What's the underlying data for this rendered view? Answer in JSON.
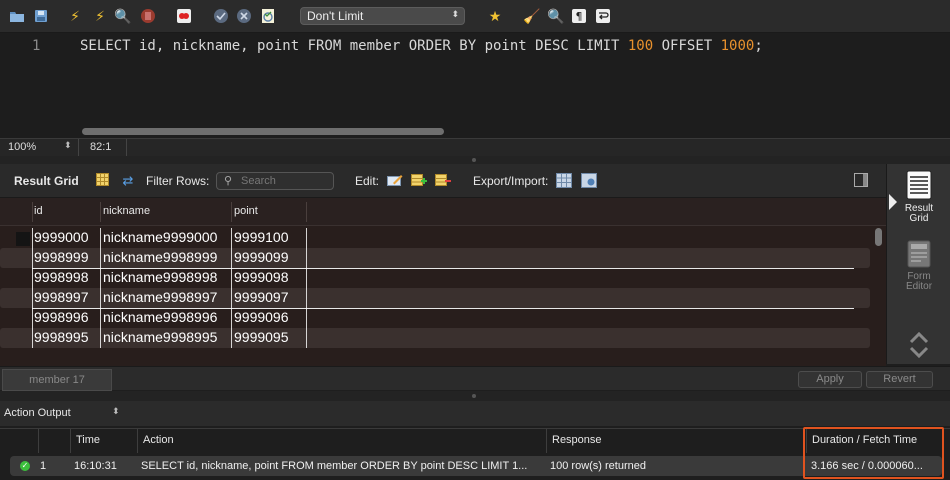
{
  "toolbar": {
    "limit_select": "Don't Limit",
    "icons": [
      "folder-icon",
      "save-icon",
      "execute-icon",
      "execute-current-icon",
      "explain-icon",
      "stop-icon",
      "toggle-error-icon",
      "commit-icon",
      "rollback-icon",
      "autocommit-icon",
      "limit-dropdown",
      "bookmark-icon",
      "beautify-icon",
      "find-icon",
      "invisible-chars-icon",
      "wrap-icon"
    ]
  },
  "editor": {
    "line_number": "1",
    "code_parts": {
      "before_100": "SELECT id, nickname, point FROM member ORDER BY point DESC LIMIT ",
      "num1": "100",
      "middle": " OFFSET ",
      "num2": "1000",
      "after": ";"
    }
  },
  "statusbar": {
    "zoom": "100%",
    "cursor_position": "82:1"
  },
  "result_toolbar": {
    "result_grid": "Result Grid",
    "filter_rows": "Filter Rows:",
    "search_placeholder": "Search",
    "edit": "Edit:",
    "export_import": "Export/Import:"
  },
  "grid": {
    "columns": [
      "id",
      "nickname",
      "point"
    ],
    "rows": [
      {
        "id": "9999000",
        "nickname": "nickname9999000",
        "point": "9999100"
      },
      {
        "id": "9998999",
        "nickname": "nickname9998999",
        "point": "9999099"
      },
      {
        "id": "9998998",
        "nickname": "nickname9998998",
        "point": "9999098"
      },
      {
        "id": "9998997",
        "nickname": "nickname9998997",
        "point": "9999097"
      },
      {
        "id": "9998996",
        "nickname": "nickname9998996",
        "point": "9999096"
      },
      {
        "id": "9998995",
        "nickname": "nickname9998995",
        "point": "9999095"
      }
    ]
  },
  "side_panel": {
    "result_grid_line1": "Result",
    "result_grid_line2": "Grid",
    "form_editor_line1": "Form",
    "form_editor_line2": "Editor"
  },
  "tabs": {
    "active_tab": "member 17",
    "apply": "Apply",
    "revert": "Revert"
  },
  "output": {
    "title": "Action Output",
    "columns": {
      "time": "Time",
      "action": "Action",
      "response": "Response",
      "duration": "Duration / Fetch Time"
    },
    "rows": [
      {
        "index": "1",
        "time": "16:10:31",
        "action": "SELECT id, nickname, point FROM member ORDER BY point DESC LIMIT 1...",
        "response": "100 row(s) returned",
        "duration": "3.166 sec / 0.000060..."
      }
    ]
  },
  "colors": {
    "highlight": "#e0531f",
    "number_literal": "#e8912d",
    "ok_status": "#3cbf3c"
  }
}
